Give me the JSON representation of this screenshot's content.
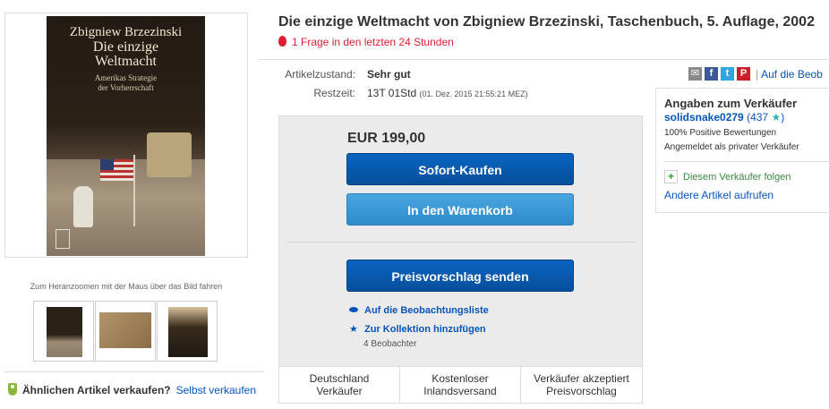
{
  "gallery": {
    "cover_author": "Zbigniew Brzezinski",
    "cover_title_line1": "Die einzige",
    "cover_title_line2": "Weltmacht",
    "cover_subtitle_line1": "Amerikas Strategie",
    "cover_subtitle_line2": "der Vorherrschaft",
    "zoom_hint": "Zum Heranzoomen mit der Maus über das Bild fahren",
    "thumbnail_count": 3
  },
  "sell_similar": {
    "question": "Ähnlichen Artikel verkaufen?",
    "link": "Selbst verkaufen"
  },
  "item": {
    "title": "Die einzige Weltmacht von Zbigniew Brzezinski, Taschenbuch, 5. Auflage, 2002",
    "urgency": "1 Frage in den letzten 24 Stunden",
    "condition_label": "Artikelzustand:",
    "condition_value": "Sehr gut",
    "time_label": "Restzeit:",
    "time_value": "13T 01Std",
    "time_date": "(01. Dez. 2015  21:55:21 MEZ)"
  },
  "share": {
    "icons": [
      "mail-icon",
      "facebook-icon",
      "twitter-icon",
      "pinterest-icon"
    ],
    "watch_link": "Auf die Beob"
  },
  "buybox": {
    "price": "EUR 199,00",
    "buy_now": "Sofort-Kaufen",
    "add_to_cart": "In den Warenkorb",
    "make_offer": "Preisvorschlag senden",
    "add_to_watchlist": "Auf die Beobachtungsliste",
    "add_to_collection": "Zur Kollektion hinzufügen",
    "watchers": "4 Beobachter",
    "features": [
      {
        "line1": "Deutschland",
        "line2": "Verkäufer"
      },
      {
        "line1": "Kostenloser",
        "line2": "Inlandsversand"
      },
      {
        "line1": "Verkäufer akzeptiert",
        "line2": "Preisvorschlag"
      }
    ]
  },
  "seller": {
    "title": "Angaben zum Verkäufer",
    "name": "solidsnake0279",
    "score": "(437",
    "score_close": ")",
    "positive": "100% Positive Bewertungen",
    "registered": "Angemeldet als privater Verkäufer",
    "follow": "Diesem Verkäufer folgen",
    "other_items": "Andere Artikel aufrufen"
  },
  "colors": {
    "link": "#0654ba",
    "urgency": "#dd1e31",
    "primary_button": "#0a64c0",
    "secondary_button": "#4aa6e0"
  }
}
